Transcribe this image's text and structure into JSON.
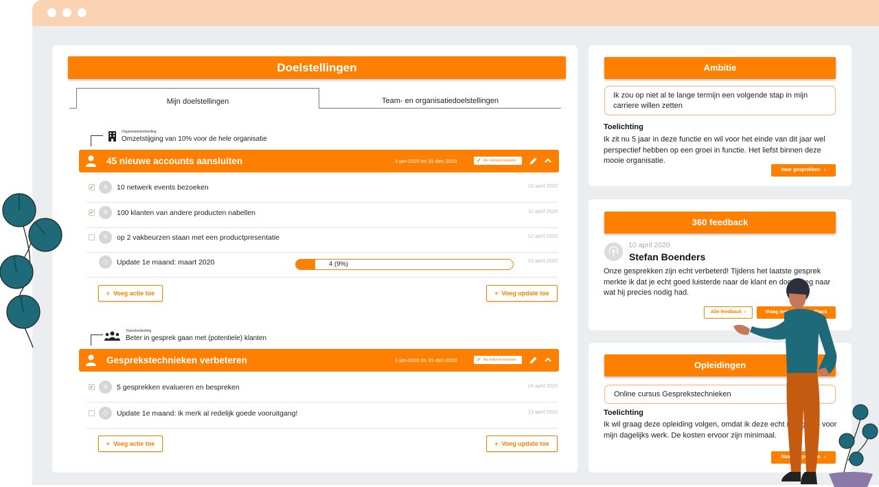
{
  "colors": {
    "accent": "#ff7f00",
    "titlebar": "#fad3b3",
    "bg": "#ebeef0",
    "leaf": "#1f6a78",
    "person_shirt": "#1f6a78",
    "person_pants": "#c55a11"
  },
  "main": {
    "title": "Doelstellingen",
    "tabs": [
      {
        "label": "Mijn doelstellingen",
        "active": true
      },
      {
        "label": "Team- en organisatiedoelstellingen",
        "active": false
      }
    ],
    "goals": [
      {
        "parent_tag": "Organisatiedoelstelling",
        "parent_text": "Omzetstijging van 10% voor de hele organisatie",
        "parent_icon": "building-icon",
        "title": "45 nieuwe accounts aansluiten",
        "dates": "1-jan-2020 tm 31-dec-2020",
        "mark_done": "Als voltooid markeren",
        "rows": [
          {
            "checked": true,
            "icon": "list-icon",
            "text": "10 netwerk events bezoeken",
            "date": "10 april 2020"
          },
          {
            "checked": true,
            "icon": "list-icon",
            "text": "100 klanten van andere producten nabellen",
            "date": "11 april 2020"
          },
          {
            "checked": false,
            "icon": "list-icon",
            "text": "op 2 vakbeurzen staan met een productpresentatie",
            "date": "12 april 2020"
          },
          {
            "checked": null,
            "icon": "update-icon",
            "text": "Update 1e maand: maart 2020",
            "date": "13 april 2020",
            "progress_label": "4 (9%)",
            "progress": 0.09
          }
        ],
        "add_action": "Voeg actie toe",
        "add_update": "Voeg update toe"
      },
      {
        "parent_tag": "Teamdoelstelling",
        "parent_text": "Beter in gesprek gaan met (potentiele) klanten",
        "parent_icon": "team-icon",
        "title": "Gesprekstechnieken verbeteren",
        "dates": "1-jan-2020 tm 31-dec-2020",
        "mark_done": "Als voltooid markeren",
        "rows": [
          {
            "checked": true,
            "icon": "list-icon",
            "text": "5 gesprekken evalueren en bespreken",
            "date": "10 april 2020"
          },
          {
            "checked": false,
            "icon": "update-icon",
            "text": "Update 1e maand: ik merk al redelijk goede vooruitgang!",
            "date": "13 april 2020"
          }
        ],
        "add_action": "Voeg actie toe",
        "add_update": "Voeg update toe"
      }
    ]
  },
  "ambitie": {
    "title": "Ambitie",
    "bubble": "Ik zou op niet al te lange termijn een volgende stap in mijn carriere willen zetten",
    "label": "Toelichting",
    "text": "Ik zit nu 5 jaar in deze functie en wil voor het einde van dit jaar wel perspectief hebben op een groei in functie. Het liefst binnen deze mooie organisatie.",
    "button": "Naar gesprekken"
  },
  "feedback": {
    "title": "360 feedback",
    "date": "10 april 2020",
    "name": "Stefan Boenders",
    "text": "Onze gesprekken zijn echt verbeterd! Tijdens het laatste gesprek merkte ik dat je echt goed luisterde naar de klant en doorvroeg naar wat hij precies nodig had.",
    "btn_all": "Alle feedback",
    "btn_ask": "Vraag iemand om feedback"
  },
  "opleidingen": {
    "title": "Opleidingen",
    "bubble": "Online cursus Gesprekstechnieken",
    "label": "Toelichting",
    "text": "Ik wil graag deze opleiding volgen, omdat ik deze echt nodig heb voor mijn dagelijks werk. De kosten ervoor zijn minimaal.",
    "button": "Naar gesprekken"
  }
}
